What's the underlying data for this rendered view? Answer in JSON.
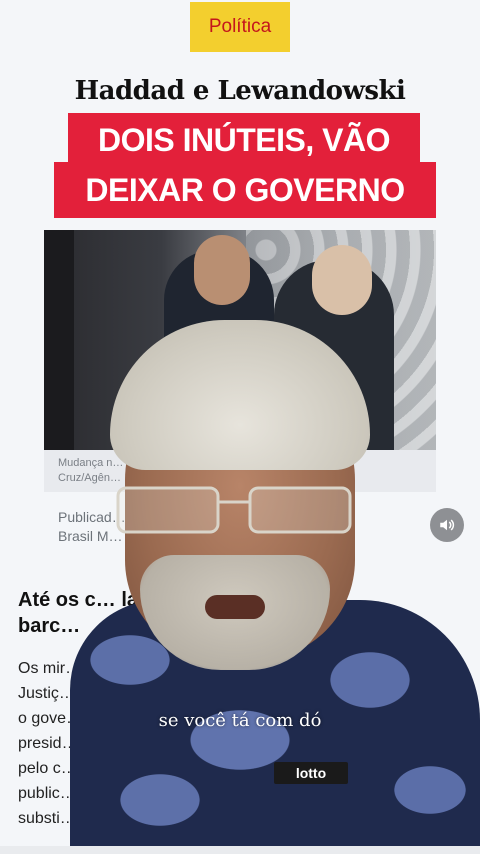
{
  "article": {
    "category": "Política",
    "headline": "Haddad e Lewandowski",
    "banner_line1": "DOIS INÚTEIS, VÃO",
    "banner_line2": "DEIXAR O GOVERNO",
    "photo_caption_line1": "Mudança n… semana | José",
    "photo_caption_line2": "Cruz/Agên…",
    "byline_line1": "Publicad… osé Cruz/Agência",
    "byline_line2": "Brasil  M…",
    "subheading_line1": "Até os c… lando do",
    "subheading_line2": "barc…",
    "body_lines": [
      "Os mir…",
      "Justiç…",
      "o gove…",
      "presid…",
      "pelo c…",
      "public…",
      "substi…"
    ]
  },
  "overlay": {
    "subtitle": "se você tá com dó",
    "shirt_logo": "lotto"
  },
  "colors": {
    "badge_bg": "#f3cf2e",
    "badge_text": "#c4161c",
    "banner_bg": "#e3203a"
  },
  "icons": {
    "sound": "speaker-icon"
  }
}
